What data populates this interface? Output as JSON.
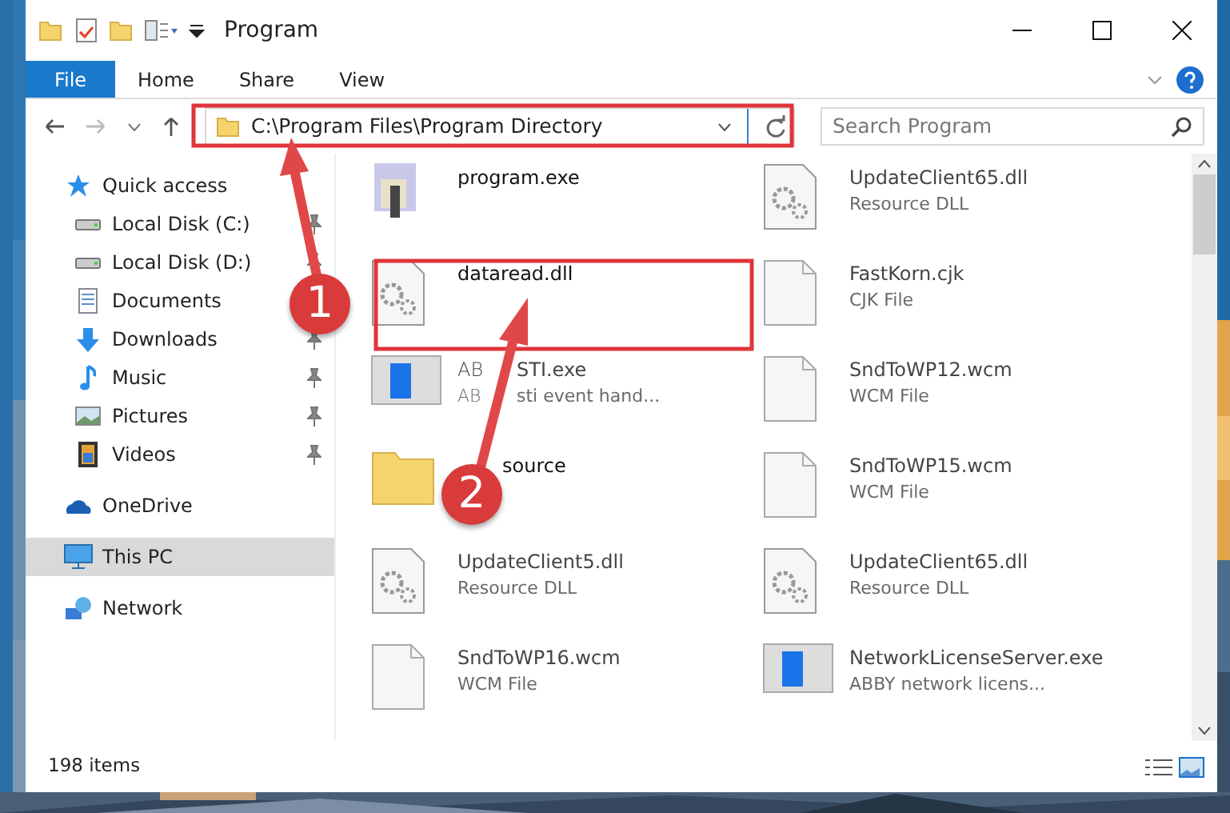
{
  "window": {
    "title": "Program"
  },
  "ribbon_tabs": [
    {
      "label": "File",
      "selected": true
    },
    {
      "label": "Home",
      "selected": false
    },
    {
      "label": "Share",
      "selected": false
    },
    {
      "label": "View",
      "selected": false
    }
  ],
  "address": {
    "value": "C:\\Program Files\\Program Directory"
  },
  "search": {
    "placeholder": "Search Program"
  },
  "sidebar": {
    "items": [
      {
        "label": "Quick access",
        "kind": "star",
        "selected": false,
        "children": [
          {
            "label": "Local Disk (C:)",
            "kind": "drive",
            "pinned": true,
            "selected": false
          },
          {
            "label": "Local Disk (D:)",
            "kind": "drive",
            "pinned": true,
            "selected": false
          },
          {
            "label": "Documents",
            "kind": "documents",
            "selected": false
          },
          {
            "label": "Downloads",
            "kind": "downloads",
            "pinned": true,
            "selected": false
          },
          {
            "label": "Music",
            "kind": "music",
            "pinned": true,
            "selected": false
          },
          {
            "label": "Pictures",
            "kind": "pictures",
            "pinned": true,
            "selected": false
          },
          {
            "label": "Videos",
            "kind": "videos",
            "pinned": true,
            "selected": false
          }
        ]
      },
      {
        "label": "OneDrive",
        "kind": "cloud",
        "selected": false
      },
      {
        "label": "This PC",
        "kind": "pc",
        "selected": true
      },
      {
        "label": "Network",
        "kind": "network",
        "selected": false
      }
    ]
  },
  "files": [
    {
      "name_parts": [
        "program.exe"
      ],
      "kind": "exe"
    },
    {
      "name_parts": [
        "UpdateClient65.dll"
      ],
      "type_parts": [
        "Resource DLL"
      ],
      "kind": "dll"
    },
    {
      "name_parts": [
        "dataread.dll"
      ],
      "kind": "dll"
    },
    {
      "name_parts": [
        "FastKorn.cjk"
      ],
      "type_parts": [
        "CJK File"
      ],
      "kind": "file"
    },
    {
      "name_parts": [
        "AB",
        "STI.exe"
      ],
      "type_parts": [
        "AB",
        "sti event hand..."
      ],
      "kind": "app"
    },
    {
      "name_parts": [
        "SndToWP12.wcm"
      ],
      "type_parts": [
        "WCM File"
      ],
      "kind": "file"
    },
    {
      "name_parts": [
        "source"
      ],
      "kind": "folder",
      "covered": true
    },
    {
      "name_parts": [
        "SndToWP15.wcm"
      ],
      "type_parts": [
        "WCM File"
      ],
      "kind": "file"
    },
    {
      "name_parts": [
        "UpdateClient5.dll"
      ],
      "type_parts": [
        "Resource DLL"
      ],
      "kind": "dll"
    },
    {
      "name_parts": [
        "UpdateClient65.dll"
      ],
      "type_parts": [
        "Resource DLL"
      ],
      "kind": "dll"
    },
    {
      "name_parts": [
        "SndToWP16.wcm"
      ],
      "type_parts": [
        "WCM File"
      ],
      "kind": "file"
    },
    {
      "name_parts": [
        "NetworkLicenseServer.exe"
      ],
      "type_parts": [
        "ABBY network licens..."
      ],
      "kind": "app"
    }
  ],
  "status_bar": {
    "count": "198 items"
  },
  "annotations": [
    {
      "label": "1"
    },
    {
      "label": "2"
    }
  ]
}
